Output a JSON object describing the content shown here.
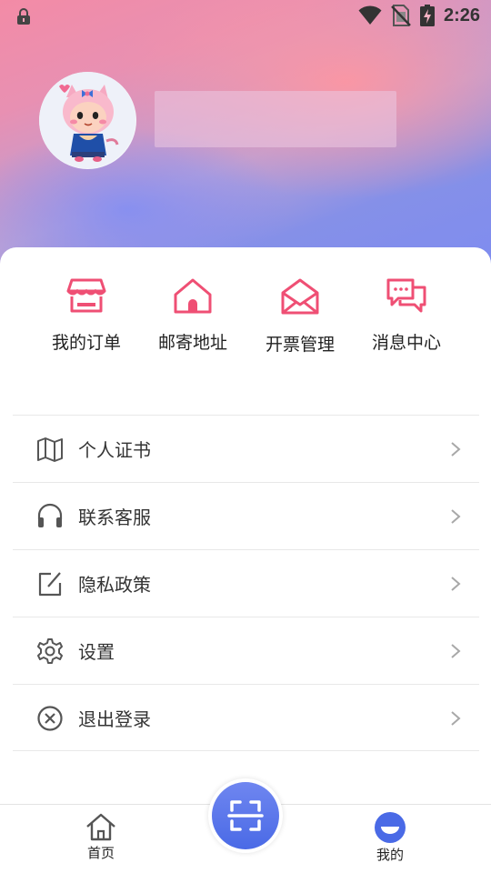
{
  "status_bar": {
    "time": "2:26",
    "icons": [
      "lock-icon",
      "wifi-icon",
      "no-sim-icon",
      "battery-charging-icon"
    ]
  },
  "profile": {
    "avatar": "cartoon-character-avatar"
  },
  "quick_actions": [
    {
      "label": "我的订单",
      "icon": "store-icon"
    },
    {
      "label": "邮寄地址",
      "icon": "house-icon"
    },
    {
      "label": "开票管理",
      "icon": "envelope-icon"
    },
    {
      "label": "消息中心",
      "icon": "chat-bubbles-icon"
    }
  ],
  "menu": [
    {
      "label": "个人证书",
      "icon": "map-icon"
    },
    {
      "label": "联系客服",
      "icon": "headset-icon"
    },
    {
      "label": "隐私政策",
      "icon": "edit-icon"
    },
    {
      "label": "设置",
      "icon": "gear-icon"
    },
    {
      "label": "退出登录",
      "icon": "close-circle-icon"
    }
  ],
  "tabbar": {
    "home_label": "首页",
    "mine_label": "我的",
    "scan_icon": "scan-icon"
  },
  "colors": {
    "accent_pink": "#ef4f74",
    "accent_blue": "#4a6ae6",
    "icon_gray": "#555555",
    "chevron_gray": "#a8a8a8"
  }
}
